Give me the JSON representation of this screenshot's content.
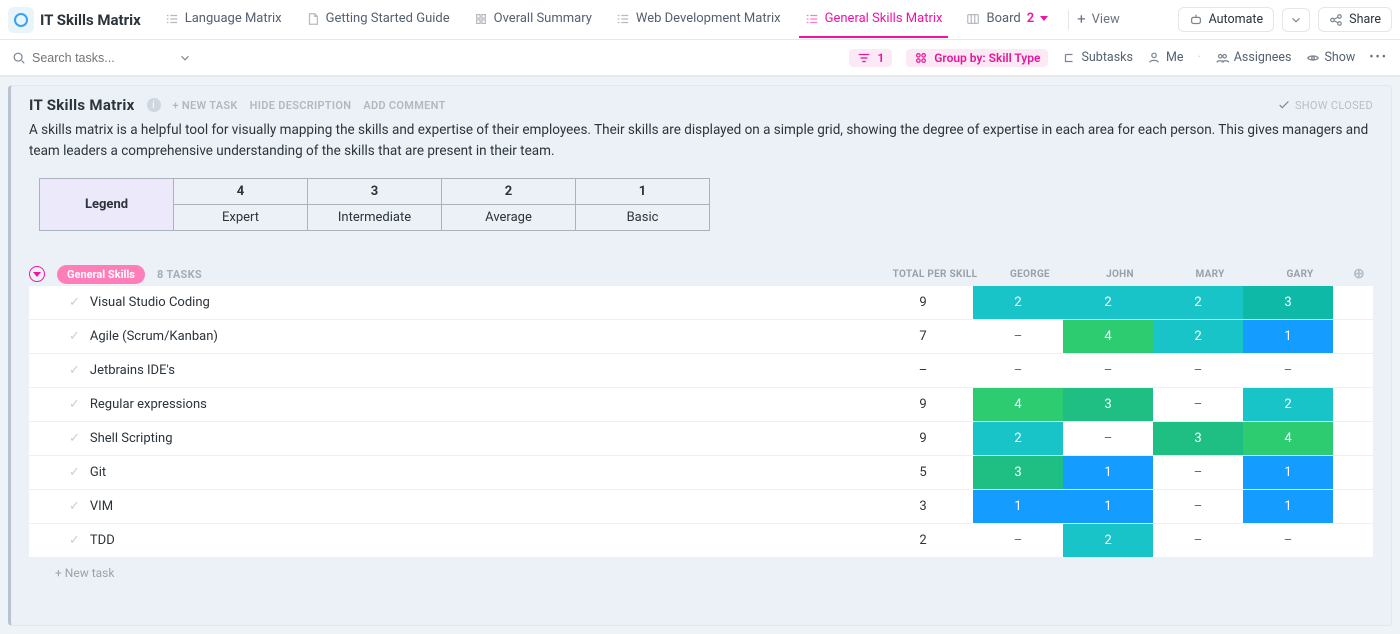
{
  "workspace_title": "IT Skills Matrix",
  "tabs": [
    {
      "label": "Language Matrix"
    },
    {
      "label": "Getting Started Guide"
    },
    {
      "label": "Overall Summary"
    },
    {
      "label": "Web Development Matrix"
    },
    {
      "label": "General Skills Matrix"
    },
    {
      "label": "Board",
      "count": "2"
    }
  ],
  "addview_label": "View",
  "automate_label": "Automate",
  "share_label": "Share",
  "search_placeholder": "Search tasks...",
  "toolbar": {
    "filter_count": "1",
    "group_by_label": "Group by: Skill Type",
    "subtasks": "Subtasks",
    "me": "Me",
    "assignees": "Assignees",
    "show": "Show"
  },
  "card": {
    "title": "IT Skills Matrix",
    "new_task": "+ NEW TASK",
    "hide_desc": "HIDE DESCRIPTION",
    "add_comment": "ADD COMMENT",
    "show_closed": "SHOW CLOSED",
    "description": "A skills matrix is a helpful tool for visually mapping the skills and expertise of their employees. Their skills are displayed on a simple grid, showing the degree of expertise in each area for each person. This gives managers and team leaders a comprehensive understanding of the skills that are present in their team."
  },
  "legend": {
    "title": "Legend",
    "cols": [
      "4",
      "3",
      "2",
      "1"
    ],
    "labels": [
      "Expert",
      "Intermediate",
      "Average",
      "Basic"
    ]
  },
  "group": {
    "name": "General Skills",
    "count_label": "8 TASKS",
    "columns": {
      "total": "TOTAL PER SKILL",
      "people": [
        "GEORGE",
        "JOHN",
        "MARY",
        "GARY"
      ]
    }
  },
  "rows": [
    {
      "name": "Visual Studio Coding",
      "total": "9",
      "cells": [
        {
          "v": "2",
          "c": "c2"
        },
        {
          "v": "2",
          "c": "c2"
        },
        {
          "v": "2",
          "c": "c2"
        },
        {
          "v": "3",
          "c": "caqua"
        }
      ]
    },
    {
      "name": "Agile (Scrum/Kanban)",
      "total": "7",
      "cells": [
        {
          "v": "–",
          "c": "plain"
        },
        {
          "v": "4",
          "c": "c4"
        },
        {
          "v": "2",
          "c": "c2"
        },
        {
          "v": "1",
          "c": "c1"
        }
      ]
    },
    {
      "name": "Jetbrains IDE's",
      "total": "–",
      "cells": [
        {
          "v": "–",
          "c": "plain"
        },
        {
          "v": "–",
          "c": "plain"
        },
        {
          "v": "–",
          "c": "plain"
        },
        {
          "v": "–",
          "c": "plain"
        }
      ]
    },
    {
      "name": "Regular expressions",
      "total": "9",
      "cells": [
        {
          "v": "4",
          "c": "c4"
        },
        {
          "v": "3",
          "c": "cell3g"
        },
        {
          "v": "–",
          "c": "plain"
        },
        {
          "v": "2",
          "c": "c2"
        }
      ]
    },
    {
      "name": "Shell Scripting",
      "total": "9",
      "cells": [
        {
          "v": "2",
          "c": "c2"
        },
        {
          "v": "–",
          "c": "plain"
        },
        {
          "v": "3",
          "c": "cell3g"
        },
        {
          "v": "4",
          "c": "c4"
        }
      ]
    },
    {
      "name": "Git",
      "total": "5",
      "cells": [
        {
          "v": "3",
          "c": "cell3g"
        },
        {
          "v": "1",
          "c": "c1"
        },
        {
          "v": "–",
          "c": "plain"
        },
        {
          "v": "1",
          "c": "c1"
        }
      ]
    },
    {
      "name": "VIM",
      "total": "3",
      "cells": [
        {
          "v": "1",
          "c": "c1"
        },
        {
          "v": "1",
          "c": "c1"
        },
        {
          "v": "–",
          "c": "plain"
        },
        {
          "v": "1",
          "c": "c1"
        }
      ]
    },
    {
      "name": "TDD",
      "total": "2",
      "cells": [
        {
          "v": "–",
          "c": "plain"
        },
        {
          "v": "2",
          "c": "c2"
        },
        {
          "v": "–",
          "c": "plain"
        },
        {
          "v": "–",
          "c": "plain"
        }
      ]
    }
  ],
  "new_task_row": "+ New task"
}
